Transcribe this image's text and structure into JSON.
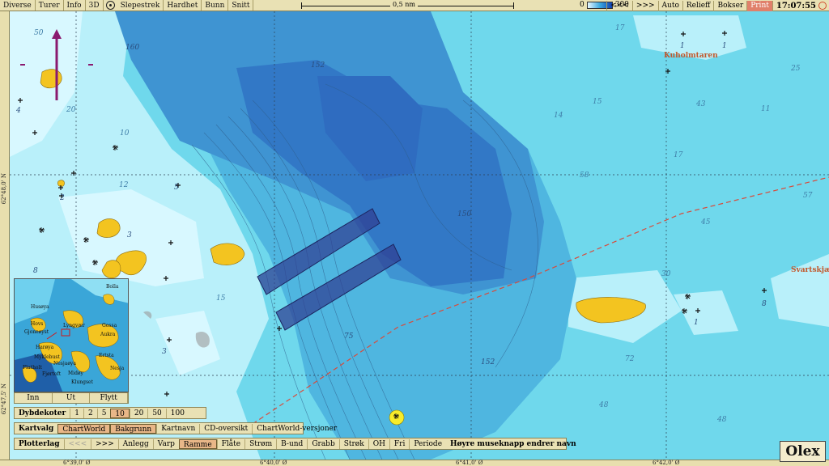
{
  "toolbar": {
    "left_menu": [
      "Diverse",
      "Turer",
      "Info",
      "3D"
    ],
    "middle_menu": [
      "Slepestrek",
      "Hardhet",
      "Bunn",
      "Snitt"
    ],
    "scale_label": "0,5 nm",
    "depth_min": "0",
    "depth_max": "300",
    "right_menu": [
      "<<<",
      ">>>",
      "Auto",
      "Relieff",
      "Bokser"
    ],
    "print_label": "Print",
    "clock": "17:07:55"
  },
  "map": {
    "latitude_labels": [
      "62°48,0' N",
      "62°47,5' N"
    ],
    "longitude_labels": [
      "6°39,0' Ø",
      "6°40,0' Ø",
      "6°41,0' Ø",
      "6°42,0' Ø"
    ],
    "place_names": [
      "Kuholmtaren",
      "Svartskjæ"
    ],
    "depths": [
      "50",
      "160",
      "152",
      "150",
      "75",
      "152",
      "58",
      "17",
      "15",
      "14",
      "43",
      "11",
      "25",
      "17",
      "57",
      "45",
      "30",
      "72",
      "48",
      "48",
      "12",
      "15",
      "10",
      "20",
      "4",
      "1",
      "2",
      "3",
      "5",
      "8",
      "8",
      "1",
      "1",
      "3"
    ]
  },
  "inset": {
    "labels": [
      "Husøya",
      "Hovs",
      "Lyngvær",
      "Gossa",
      "Gjoneøyst",
      "Aukra",
      "Harøya",
      "Myklebust",
      "Flatholt",
      "Nesjaøya",
      "Fjørtoft",
      "Ertsta",
      "Midøy",
      "Klungset",
      "Bolla",
      "Nesja"
    ],
    "buttons": [
      "Inn",
      "Ut",
      "Flytt"
    ]
  },
  "dybdekoter": {
    "title": "Dybdekoter",
    "options": [
      "1",
      "2",
      "5",
      "10",
      "20",
      "50",
      "100"
    ],
    "selected": "10"
  },
  "kartvalg": {
    "title": "Kartvalg",
    "options": [
      "ChartWorld",
      "Bakgrunn",
      "Kartnavn",
      "CD-oversikt",
      "ChartWorld-versjoner"
    ],
    "selected": [
      "ChartWorld",
      "Bakgrunn"
    ]
  },
  "plotterlag": {
    "title": "Plotterlag",
    "nav": [
      "<<<",
      ">>>"
    ],
    "options": [
      "Anlegg",
      "Varp",
      "Ramme",
      "Flåte",
      "Strøm",
      "B-und",
      "Grabb",
      "Strøk",
      "OH",
      "Fri",
      "Periode"
    ],
    "selected": "Ramme",
    "hint": "Høyre museknapp endrer navn"
  },
  "brand": "Olex",
  "colors": {
    "shallow_water": "#b9f0fa",
    "mid_water": "#6fd8ec",
    "deep_water": "#2f9ad4",
    "deepest_water": "#2f6cc0",
    "land": "#f3c420",
    "plot_box": "#2f3f92",
    "route": "#d94a3a"
  }
}
